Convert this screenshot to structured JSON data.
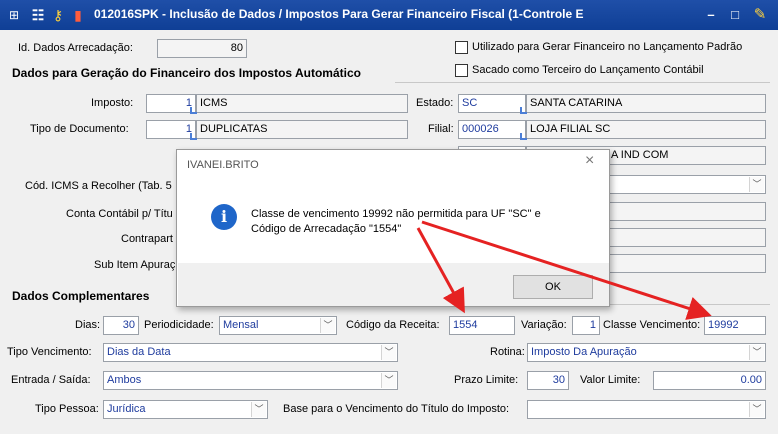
{
  "window": {
    "title": "012016SPK - Inclusão de Dados / Impostos Para Gerar Financeiro Fiscal (1-Controle E",
    "minimize": "–",
    "restore": "□"
  },
  "id": {
    "label": "Id. Dados Arrecadação:",
    "value": "80"
  },
  "checks": {
    "utilizado": "Utilizado para Gerar Financeiro no Lançamento Padrão",
    "sacado": "Sacado como Terceiro do Lançamento Contábil"
  },
  "section1": {
    "title": "Dados para Geração do Financeiro dos Impostos Automático"
  },
  "imposto": {
    "label": "Imposto:",
    "code": "1",
    "desc": "ICMS"
  },
  "tipo_doc": {
    "label": "Tipo de Documento:",
    "code": "1",
    "desc": "DUPLICATAS"
  },
  "estado": {
    "label": "Estado:",
    "code": "SC",
    "desc": "SANTA CATARINA"
  },
  "filial": {
    "label": "Filial:",
    "code": "000026",
    "desc": "LOJA FILIAL SC"
  },
  "hidden_row": {
    "desc_tail": "A IND COM"
  },
  "cod_icms": {
    "label": "Cód. ICMS a Recolher (Tab. 5"
  },
  "conta": {
    "label": "Conta Contábil p/ Títu"
  },
  "contrapartida": {
    "label": "Contrapart"
  },
  "subitem": {
    "label": "Sub Item Apuraç"
  },
  "section2": {
    "title": "Dados Complementares"
  },
  "dias": {
    "label": "Dias:",
    "value": "30"
  },
  "periodicidade": {
    "label": "Periodicidade:",
    "value": "Mensal"
  },
  "codigo_receita": {
    "label": "Código da Receita:",
    "value": "1554"
  },
  "variacao": {
    "label": "Variação:",
    "value": "1"
  },
  "classe_venc": {
    "label": "Classe Vencimento:",
    "value": "19992"
  },
  "tipo_venc": {
    "label": "Tipo Vencimento:",
    "value": "Dias da Data"
  },
  "rotina": {
    "label": "Rotina:",
    "value": "Imposto Da Apuração"
  },
  "entrada_saida": {
    "label": "Entrada / Saída:",
    "value": "Ambos"
  },
  "prazo": {
    "label": "Prazo Limite:",
    "value": "30"
  },
  "valor": {
    "label": "Valor Limite:",
    "value": "0.00"
  },
  "tipo_pessoa": {
    "label": "Tipo Pessoa:",
    "value": "Jurídica"
  },
  "base_venc": {
    "label": "Base para o Vencimento do Título do Imposto:",
    "value": ""
  },
  "dialog": {
    "title": "IVANEI.BRITO",
    "close": "×",
    "icon": "i",
    "line1": "Classe de vencimento 19992 não permitida para UF \"SC\" e",
    "line2": "Código de Arrecadação \"1554\"",
    "ok": "OK"
  },
  "colors": {
    "titlebar": "#1f4fa8",
    "arrow": "#e52222",
    "info": "#1f66c9",
    "link": "#1f3c9e"
  }
}
